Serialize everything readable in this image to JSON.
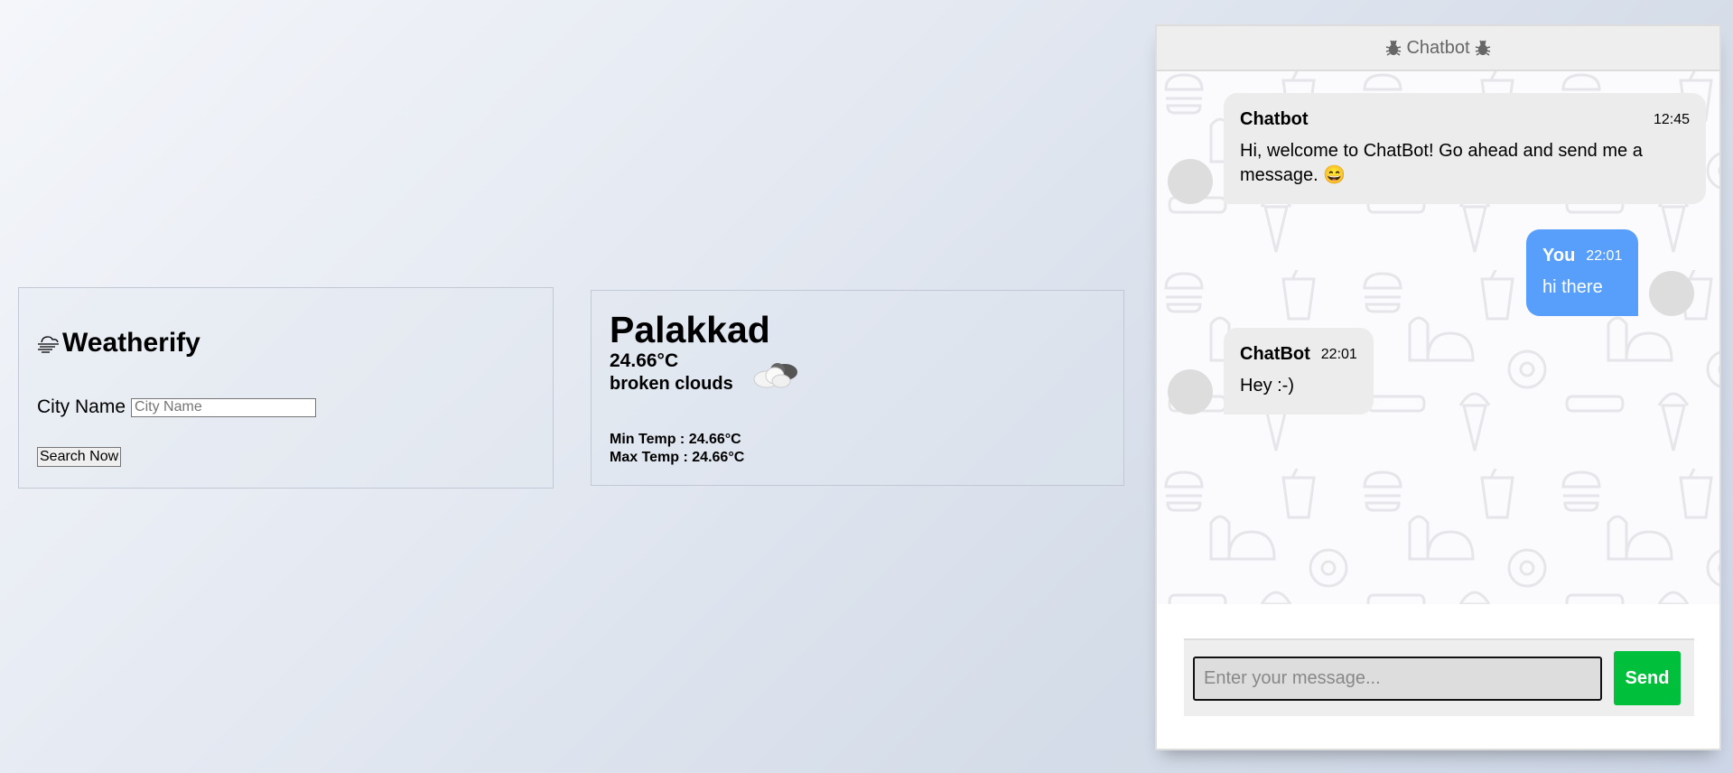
{
  "weather_form": {
    "app_title": "Weatherify",
    "city_label": "City Name",
    "city_placeholder": "City Name",
    "city_value": "",
    "search_button": "Search Now"
  },
  "weather_result": {
    "city": "Palakkad",
    "temperature": "24.66°C",
    "description": "broken clouds",
    "min_temp": "Min Temp : 24.66°C",
    "max_temp": "Max Temp : 24.66°C",
    "icon": "broken-clouds-icon"
  },
  "chat": {
    "header_title": "Chatbot",
    "header_icon": "bug-icon",
    "messages": [
      {
        "side": "left",
        "name": "Chatbot",
        "time": "12:45",
        "text": "Hi, welcome to ChatBot! Go ahead and send me a message. 😄"
      },
      {
        "side": "right",
        "name": "You",
        "time": "22:01",
        "text": "hi there"
      },
      {
        "side": "left",
        "name": "ChatBot",
        "time": "22:01",
        "text": "Hey :-)"
      }
    ],
    "input_placeholder": "Enter your message...",
    "input_value": "",
    "send_label": "Send",
    "colors": {
      "user_bubble": "#579ffb",
      "bot_bubble": "#ececec",
      "send_button": "#00c03b"
    }
  }
}
